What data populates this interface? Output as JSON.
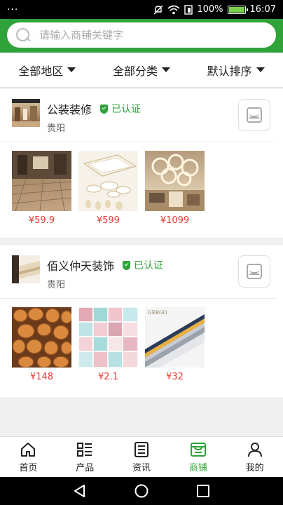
{
  "status_bar": {
    "left_dots": "···",
    "battery_text": "100%",
    "battery_level": 1.0,
    "time": "16:07"
  },
  "search": {
    "placeholder": "请输入商铺关键字",
    "value": ""
  },
  "filters": [
    {
      "label": "全部地区"
    },
    {
      "label": "全部分类"
    },
    {
      "label": "默认排序"
    }
  ],
  "stores": [
    {
      "name": "公装装修",
      "verified_label": "已认证",
      "city": "贵阳",
      "products": [
        {
          "price": "¥59.9"
        },
        {
          "price": "¥599"
        },
        {
          "price": "¥1099"
        }
      ]
    },
    {
      "name": "佰义仲天装饰",
      "verified_label": "已认证",
      "city": "贵阳",
      "products": [
        {
          "price": "¥148"
        },
        {
          "price": "¥2.1"
        },
        {
          "price": "¥32",
          "image_text": "GERGO"
        }
      ]
    }
  ],
  "tabbar": {
    "items": [
      {
        "label": "首页",
        "icon": "home-icon"
      },
      {
        "label": "产品",
        "icon": "grid-list-icon"
      },
      {
        "label": "资讯",
        "icon": "news-icon"
      },
      {
        "label": "商铺",
        "icon": "store-icon",
        "active": true
      },
      {
        "label": "我的",
        "icon": "user-icon"
      }
    ]
  },
  "colors": {
    "brand_green": "#2fa33a",
    "price_red": "#e53935"
  }
}
